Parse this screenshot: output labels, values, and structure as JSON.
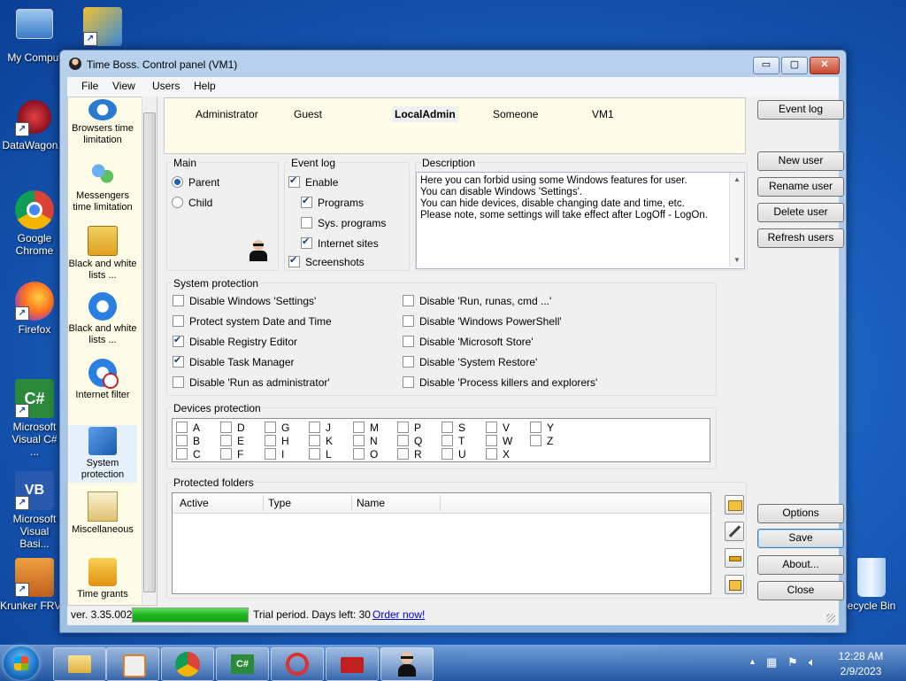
{
  "desktop": {
    "icons": [
      "My Comput",
      "DataWagon...",
      "Google Chrome",
      "Firefox",
      "Microsoft Visual C# ...",
      "Microsoft Visual Basi...",
      "Krunker FRVR",
      "ecycle Bin"
    ]
  },
  "window": {
    "title": "Time Boss. Control panel (VM1)",
    "controls": {
      "minimize": "▭",
      "maximize": "▢",
      "close": "✕"
    }
  },
  "menu": [
    "File",
    "View",
    "Users",
    "Help"
  ],
  "sidebar": {
    "items": [
      {
        "label": "Browsers time limitation"
      },
      {
        "label": "Messengers time limitation"
      },
      {
        "label": "Black and white lists ..."
      },
      {
        "label": "Black and white lists ..."
      },
      {
        "label": "Internet filter"
      },
      {
        "label": "System protection"
      },
      {
        "label": "Miscellaneous"
      },
      {
        "label": "Time grants"
      }
    ]
  },
  "users": [
    "Administrator",
    "Guest",
    "LocalAdmin",
    "Someone",
    "VM1"
  ],
  "selected_user": "LocalAdmin",
  "main_group": {
    "label": "Main",
    "options": [
      {
        "label": "Parent",
        "checked": true
      },
      {
        "label": "Child",
        "checked": false
      }
    ]
  },
  "event_log_group": {
    "label": "Event log",
    "items": [
      {
        "label": "Enable",
        "checked": true
      },
      {
        "label": "Programs",
        "checked": true
      },
      {
        "label": "Sys. programs",
        "checked": false
      },
      {
        "label": "Internet sites",
        "checked": true
      },
      {
        "label": "Screenshots",
        "checked": true
      }
    ]
  },
  "description": {
    "label": "Description",
    "text": "Here you can forbid using some Windows features for user.\nYou can disable Windows 'Settings'.\nYou can hide devices, disable changing date and time, etc.\nPlease note, some settings will take effect after LogOff - LogOn."
  },
  "system_protection": {
    "label": "System protection",
    "left": [
      {
        "label": "Disable Windows 'Settings'",
        "checked": false
      },
      {
        "label": "Protect system Date and Time",
        "checked": false
      },
      {
        "label": "Disable Registry Editor",
        "checked": true
      },
      {
        "label": "Disable Task Manager",
        "checked": true
      },
      {
        "label": "Disable 'Run as administrator'",
        "checked": false
      }
    ],
    "right": [
      {
        "label": "Disable 'Run, runas, cmd ...'",
        "checked": false
      },
      {
        "label": "Disable 'Windows PowerShell'",
        "checked": false
      },
      {
        "label": "Disable 'Microsoft Store'",
        "checked": false
      },
      {
        "label": "Disable 'System Restore'",
        "checked": false
      },
      {
        "label": "Disable 'Process killers and explorers'",
        "checked": false
      }
    ]
  },
  "devices_protection": {
    "label": "Devices protection",
    "columns": [
      [
        "A",
        "B",
        "C"
      ],
      [
        "D",
        "E",
        "F"
      ],
      [
        "G",
        "H",
        "I"
      ],
      [
        "J",
        "K",
        "L"
      ],
      [
        "M",
        "N",
        "O"
      ],
      [
        "P",
        "Q",
        "R"
      ],
      [
        "S",
        "T",
        "U"
      ],
      [
        "V",
        "W",
        "X"
      ],
      [
        "Y",
        "Z"
      ]
    ]
  },
  "protected_folders": {
    "label": "Protected folders",
    "columns": [
      "Active",
      "Type",
      "Name"
    ]
  },
  "buttons": {
    "event_log": "Event log",
    "new_user": "New user",
    "rename_user": "Rename user",
    "delete_user": "Delete user",
    "refresh_users": "Refresh users",
    "options": "Options",
    "save": "Save",
    "about": "About...",
    "close": "Close"
  },
  "status": {
    "version": "ver. 3.35.002",
    "trial": "Trial period. Days left: 30",
    "order": "Order now!",
    "progress": 1.0
  },
  "taskbar": {
    "time": "12:28 AM",
    "date": "2/9/2023"
  },
  "colors": {
    "accent": "#1a5fbf",
    "sidebar_bg": "#fffde8",
    "progress": "#1fb41f"
  }
}
